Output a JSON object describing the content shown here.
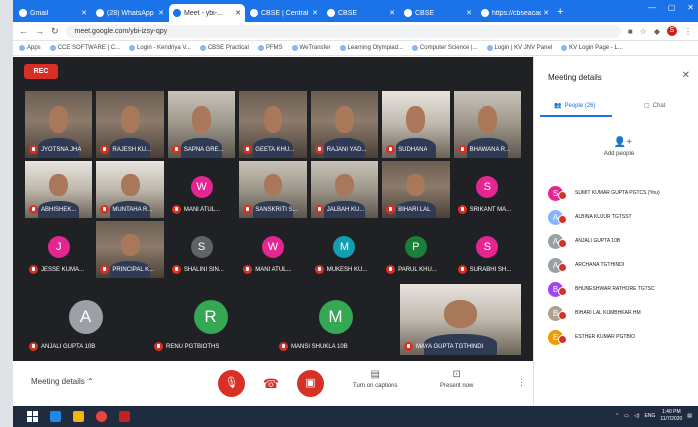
{
  "browser": {
    "tabs": [
      {
        "label": "Gmail",
        "active": false
      },
      {
        "label": "(28) WhatsApp",
        "active": false
      },
      {
        "label": "Meet - ybi-...",
        "active": true
      },
      {
        "label": "CBSE | Central Bo...",
        "active": false
      },
      {
        "label": "CBSE",
        "active": false
      },
      {
        "label": "CBSE",
        "active": false
      },
      {
        "label": "https://cbseacad...",
        "active": false
      }
    ],
    "url": "meet.google.com/ybi-izsy-qpy",
    "bookmarks": [
      "Apps",
      "CCE SOFTWARE | C...",
      "Login - Kendriya V...",
      "CBSE Practical",
      "PFMS",
      "WeTransfer",
      "Learning Olympiad...",
      "Computer Science |...",
      "Login | KV JNV Panel",
      "KV Login Page - L..."
    ]
  },
  "stage": {
    "rec_label": "REC",
    "tiles": [
      {
        "name": "JYOTSNA JHA",
        "kind": "cam"
      },
      {
        "name": "RAJESH KU...",
        "kind": "cam"
      },
      {
        "name": "SAPNA GRE...",
        "kind": "cam2"
      },
      {
        "name": "GEETA KHU...",
        "kind": "cam"
      },
      {
        "name": "RAJANI YAD...",
        "kind": "cam"
      },
      {
        "name": "SUDHANA",
        "kind": "cam3"
      },
      {
        "name": "BHAWANA R...",
        "kind": "cam2"
      },
      {
        "name": "ABHISHEK...",
        "kind": "cam3"
      },
      {
        "name": "MUNTAHA R...",
        "kind": "cam3"
      },
      {
        "name": "MANI ATUL...",
        "letter": "W",
        "color": "#e52592"
      },
      {
        "name": "SANSKRITI S...",
        "kind": "cam2"
      },
      {
        "name": "JALBAH KU...",
        "kind": "cam2"
      },
      {
        "name": "BIHARI LAL",
        "kind": "cam"
      },
      {
        "name": "SRIKANT MA...",
        "letter": "S",
        "color": "#e52592"
      },
      {
        "name": "JESSE KUMA...",
        "letter": "J",
        "color": "#e52592"
      },
      {
        "name": "PRINCIPAL K...",
        "kind": "cam"
      },
      {
        "name": "SHALINI SIN...",
        "letter": "S",
        "color": "#5f6368"
      },
      {
        "name": "MANI ATUL...",
        "letter": "W",
        "color": "#e52592"
      },
      {
        "name": "MUKESH KU...",
        "letter": "M",
        "color": "#129eaf"
      },
      {
        "name": "PARUL KHU...",
        "letter": "P",
        "color": "#188038"
      },
      {
        "name": "SURABHI SH...",
        "letter": "S",
        "color": "#e52592"
      },
      {
        "name": "ANJALI GUPTA 10B",
        "letter": "A",
        "color": "#9aa0a6"
      },
      {
        "name": "RENU PGTBIOTHS",
        "letter": "R",
        "color": "#34a853"
      },
      {
        "name": "MANSI SHUKLA 10B",
        "letter": "M",
        "color": "#34a853"
      },
      {
        "name": "MAYA GUPTA TGTHINDI",
        "kind": "cam3"
      }
    ]
  },
  "bottom": {
    "meeting_details": "Meeting details",
    "captions": "Turn on captions",
    "present": "Present now"
  },
  "side": {
    "title": "Meeting details",
    "people_tab": "People (26)",
    "chat_tab": "Chat",
    "add_people": "Add people",
    "people": [
      {
        "name": "SUMIT KUMAR GUPTA PGTCS (You)",
        "letter": "S",
        "color": "#e52592"
      },
      {
        "name": "ALBINA KUJUR TGTSST",
        "letter": "A",
        "color": "#8ab4f8"
      },
      {
        "name": "ANJALI GUPTA 10B",
        "letter": "A",
        "color": "#9aa0a6"
      },
      {
        "name": "ARCHANA TGTHINDI",
        "letter": "A",
        "color": "#9aa0a6"
      },
      {
        "name": "BHUNESHWAR RATHORE TGTSC",
        "letter": "B",
        "color": "#a142f4"
      },
      {
        "name": "BIHARI LAL KUMBHKAR HM",
        "letter": "B",
        "color": "#b0a090"
      },
      {
        "name": "ESTHER KUMAR PGTBIO",
        "letter": "E",
        "color": "#f29900"
      }
    ]
  },
  "taskbar": {
    "time": "1:40 PM",
    "date": "11/7/2020",
    "lang": "ENG"
  }
}
